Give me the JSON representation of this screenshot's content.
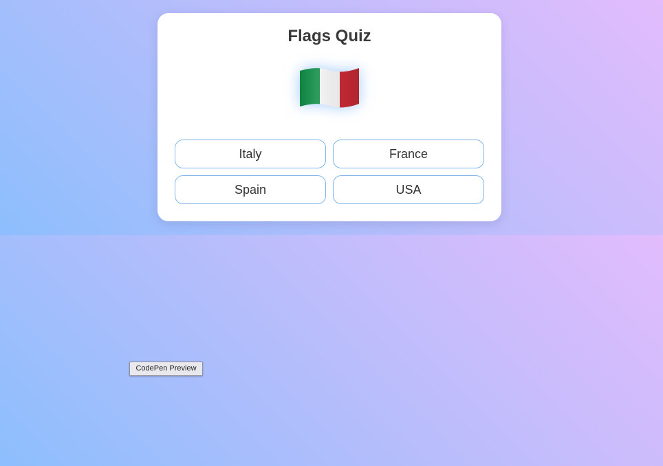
{
  "page": {
    "background_colors": [
      "#8dbefd",
      "#b9bdfb",
      "#e2bcfd"
    ]
  },
  "quiz": {
    "title": "Flags Quiz",
    "flag": {
      "icon": "italy-flag-icon",
      "colors": [
        "#0f8f46",
        "#ffffff",
        "#cd2b37"
      ]
    },
    "options": [
      {
        "label": "Italy"
      },
      {
        "label": "France"
      },
      {
        "label": "Spain"
      },
      {
        "label": "USA"
      }
    ],
    "accent_color": "#7fb6ea"
  },
  "preview_button": {
    "label": "CodePen Preview"
  }
}
